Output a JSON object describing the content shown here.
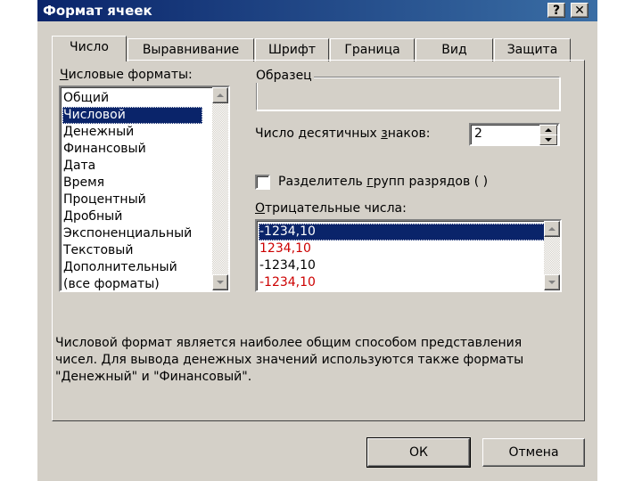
{
  "window": {
    "title": "Формат ячеек",
    "help_label": "?",
    "close_label": "✕"
  },
  "tabs": [
    {
      "label": "Число",
      "active": true
    },
    {
      "label": "Выравнивание"
    },
    {
      "label": "Шрифт"
    },
    {
      "label": "Граница"
    },
    {
      "label": "Вид"
    },
    {
      "label": "Защита"
    }
  ],
  "number_formats": {
    "label_accel": "Ч",
    "label_rest": "исловые форматы:",
    "items": [
      "Общий",
      "Числовой",
      "Денежный",
      "Финансовый",
      "Дата",
      "Время",
      "Процентный",
      "Дробный",
      "Экспоненциальный",
      "Текстовый",
      "Дополнительный",
      "(все форматы)"
    ],
    "selected": "Числовой"
  },
  "sample": {
    "label": "Образец",
    "value": ""
  },
  "decimals": {
    "label_pre": "Число десятичных ",
    "label_accel": "з",
    "label_post": "наков:",
    "value": "2"
  },
  "separator": {
    "label_pre": "Разделитель ",
    "label_accel": "г",
    "label_post": "рупп разрядов ( )",
    "checked": false
  },
  "negative": {
    "label_accel": "О",
    "label_rest": "трицательные числа:",
    "items": [
      {
        "text": "-1234,10",
        "color": "#000000"
      },
      {
        "text": "1234,10",
        "color": "#cc0000"
      },
      {
        "text": "-1234,10",
        "color": "#000000"
      },
      {
        "text": "-1234,10",
        "color": "#cc0000"
      }
    ],
    "selected": "-1234,10"
  },
  "description": {
    "line1": "Числовой формат является наиболее общим способом представления",
    "line2": "чисел. Для вывода денежных значений используются также форматы",
    "line3": "\"Денежный\" и \"Финансовый\"."
  },
  "buttons": {
    "ok_label": "ОК",
    "cancel_label": "Отмена"
  },
  "colors": {
    "title_bar": "#0a246a",
    "face": "#d4d0c8",
    "selection": "#0a246a",
    "negative_red": "#cc0000"
  }
}
